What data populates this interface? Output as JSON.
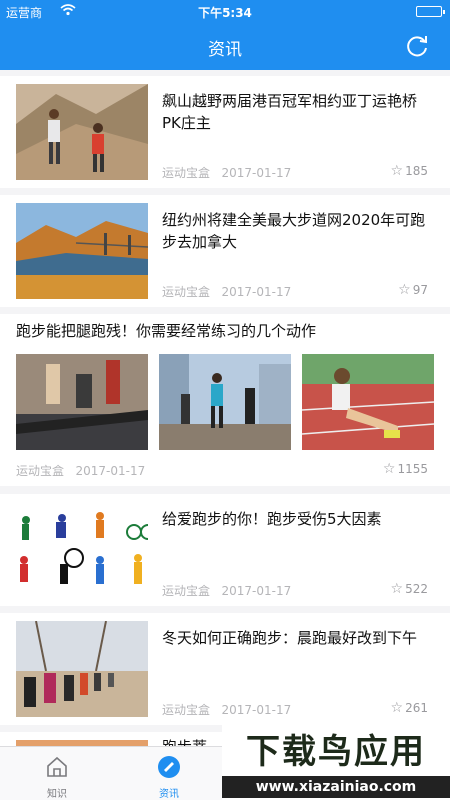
{
  "status": {
    "carrier": "运营商",
    "time": "下午5:34"
  },
  "nav": {
    "title": "资讯"
  },
  "articles": [
    {
      "title": "飙山越野两届港百冠军相约亚丁运艳桥PK庄主",
      "source": "运动宝盒",
      "date": "2017-01-17",
      "stars": "185"
    },
    {
      "title": "纽约州将建全美最大步道网2020年可跑步去加拿大",
      "source": "运动宝盒",
      "date": "2017-01-17",
      "stars": "97"
    },
    {
      "title": "跑步能把腿跑残！你需要经常练习的几个动作",
      "source": "运动宝盒",
      "date": "2017-01-17",
      "stars": "1155"
    },
    {
      "title": "给爱跑步的你！跑步受伤5大因素",
      "source": "运动宝盒",
      "date": "2017-01-17",
      "stars": "522"
    },
    {
      "title": "冬天如何正确跑步：晨跑最好改到下午",
      "source": "运动宝盒",
      "date": "2017-01-17",
      "stars": "261"
    },
    {
      "title": "跑步蒂"
    }
  ],
  "tabs": [
    {
      "label": "知识",
      "icon": "home-icon"
    },
    {
      "label": "资讯",
      "icon": "compass-icon"
    }
  ],
  "watermark": {
    "brand": "下载鸟应用",
    "url": "www.xiazainiao.com"
  },
  "colors": {
    "accent": "#1f8ef0",
    "meta": "#b5b5b8"
  }
}
